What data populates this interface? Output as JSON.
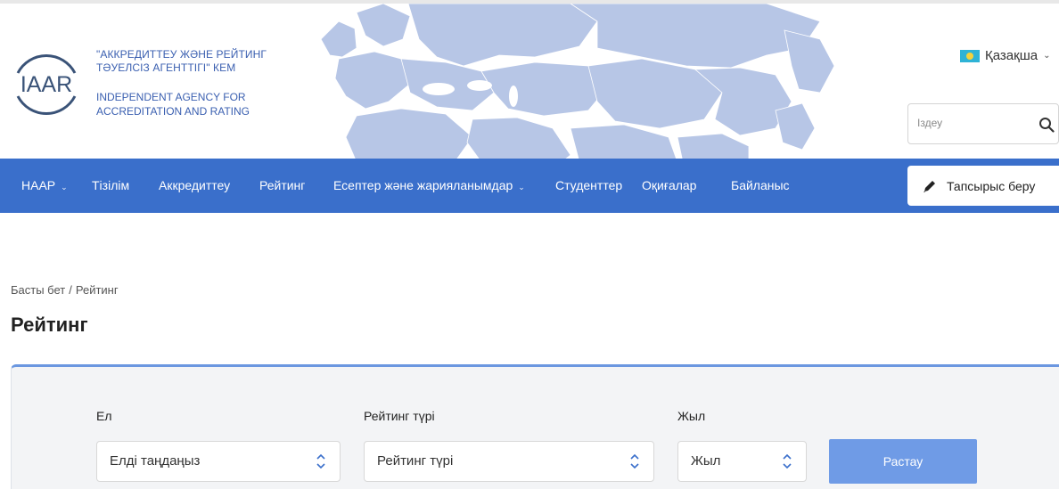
{
  "header": {
    "logo_text": "IAAR",
    "org_name_kz": "\"АККРЕДИТТЕУ ЖӘНЕ РЕЙТИНГ ТӘУЕЛСІЗ АГЕНТТІГІ\" КЕМ",
    "org_name_en": "INDEPENDENT AGENCY FOR ACCREDITATION AND RATING",
    "language": "Қазақша",
    "search_placeholder": "Іздеу"
  },
  "nav": {
    "items": [
      {
        "label": "НААР",
        "dropdown": true
      },
      {
        "label": "Тізілім",
        "dropdown": false
      },
      {
        "label": "Аккредиттеу",
        "dropdown": false
      },
      {
        "label": "Рейтинг",
        "dropdown": false
      },
      {
        "label": "Есептер және жарияланымдар",
        "dropdown": true
      },
      {
        "label": "Студенттер",
        "dropdown": false
      },
      {
        "label": "Оқиғалар",
        "dropdown": false
      },
      {
        "label": "Байланыс",
        "dropdown": false
      }
    ],
    "order_button": "Тапсырыс беру"
  },
  "breadcrumb": {
    "home": "Басты бет",
    "separator": "/",
    "current": "Рейтинг"
  },
  "page_title": "Рейтинг",
  "filters": {
    "country_label": "Ел",
    "country_value": "Елді таңдаңыз",
    "rating_type_label": "Рейтинг түрі",
    "rating_type_value": "Рейтинг түрі",
    "year_label": "Жыл",
    "year_value": "Жыл",
    "submit_label": "Растау"
  },
  "colors": {
    "nav_bg": "#3a6fcb",
    "brand_blue": "#3a5fb0",
    "submit_bg": "#6f9be6",
    "map_fill": "#b7c6e6"
  }
}
